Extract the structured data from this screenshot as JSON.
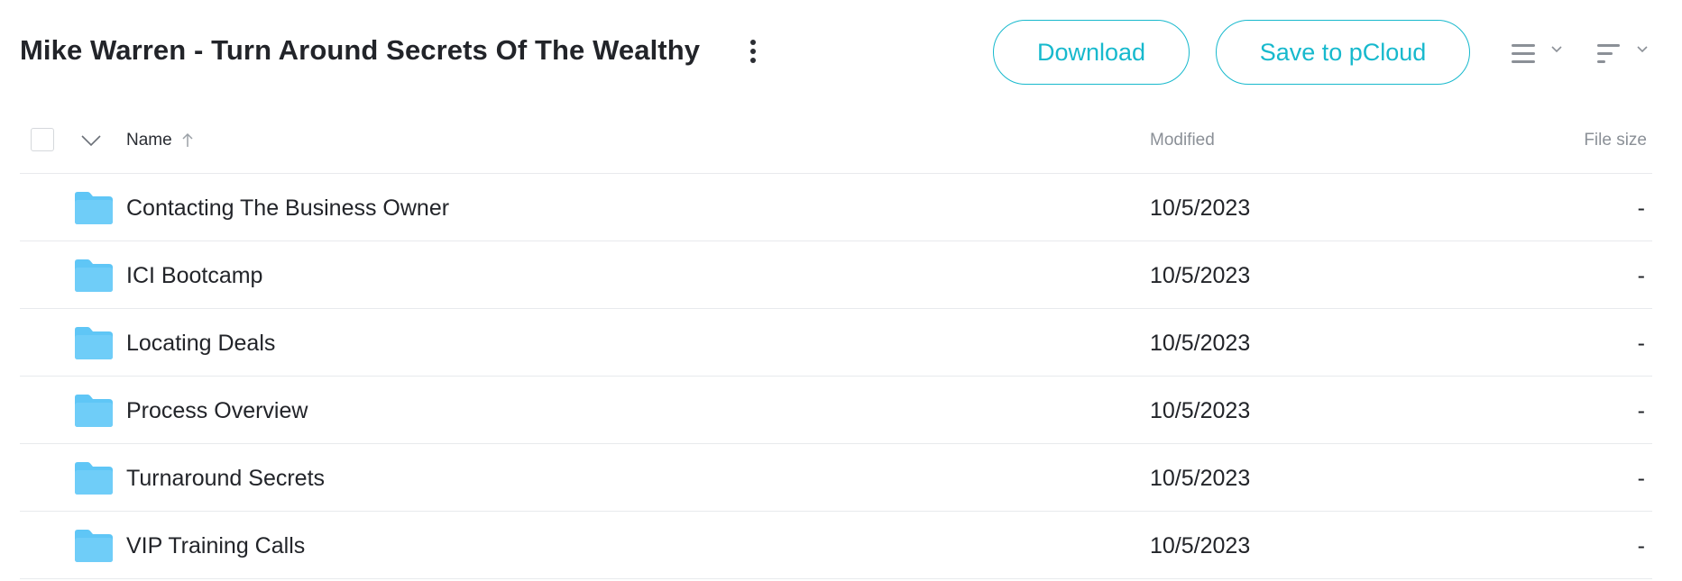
{
  "header": {
    "title": "Mike Warren - Turn Around Secrets Of The Wealthy",
    "download_label": "Download",
    "save_label": "Save to pCloud"
  },
  "table": {
    "columns": {
      "name": "Name",
      "modified": "Modified",
      "size": "File size"
    },
    "rows": [
      {
        "name": "Contacting The Business Owner",
        "modified": "10/5/2023",
        "size": "-"
      },
      {
        "name": "ICI Bootcamp",
        "modified": "10/5/2023",
        "size": "-"
      },
      {
        "name": "Locating Deals",
        "modified": "10/5/2023",
        "size": "-"
      },
      {
        "name": "Process Overview",
        "modified": "10/5/2023",
        "size": "-"
      },
      {
        "name": "Turnaround Secrets",
        "modified": "10/5/2023",
        "size": "-"
      },
      {
        "name": "VIP Training Calls",
        "modified": "10/5/2023",
        "size": "-"
      }
    ]
  },
  "icons": {
    "menu": "more-vertical-icon",
    "view": "list-view-icon",
    "sort": "sort-icon",
    "folder": "folder-icon",
    "sort_direction": "arrow-up-icon"
  },
  "colors": {
    "accent": "#17b9cd",
    "folder": "#5fc6f6",
    "divider": "#e8eaed"
  }
}
